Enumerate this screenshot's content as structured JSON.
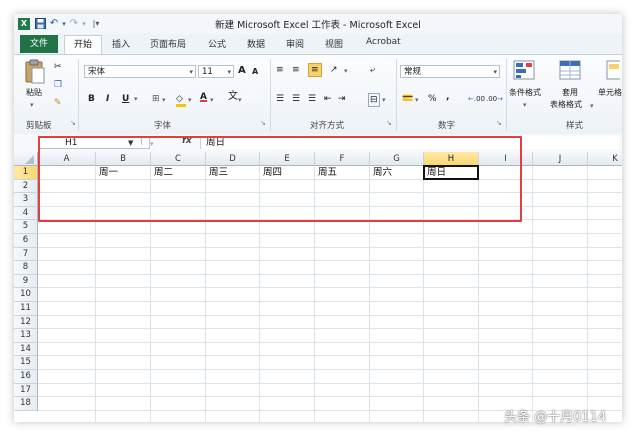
{
  "window": {
    "title": "新建 Microsoft Excel 工作表 - Microsoft Excel"
  },
  "quick_access": {
    "excel_icon": "excel-icon",
    "save_icon": "save-icon",
    "undo_icon": "undo-icon",
    "redo_icon": "redo-icon",
    "customize_icon": "customize-icon"
  },
  "tabs": [
    {
      "label": "文件"
    },
    {
      "label": "开始"
    },
    {
      "label": "插入"
    },
    {
      "label": "页面布局"
    },
    {
      "label": "公式"
    },
    {
      "label": "数据"
    },
    {
      "label": "审阅"
    },
    {
      "label": "视图"
    },
    {
      "label": "Acrobat"
    }
  ],
  "ribbon": {
    "clipboard": {
      "paste_label": "粘贴",
      "group_label": "剪贴板"
    },
    "font": {
      "name": "宋体",
      "size": "11",
      "bold": "B",
      "italic": "I",
      "underline": "U",
      "grow": "A",
      "shrink": "A",
      "wen": "wén",
      "group_label": "字体"
    },
    "alignment": {
      "group_label": "对齐方式"
    },
    "number": {
      "format": "常规",
      "percent": "%",
      "comma": ",",
      "inc_decimal": ".00",
      "dec_decimal": ".00",
      "group_label": "数字"
    },
    "styles": {
      "conditional": "条件格式",
      "table_format_1": "套用",
      "table_format_2": "表格格式",
      "cell_styles": "单元格",
      "group_label": "样式"
    }
  },
  "formula_bar": {
    "name_box": "H1",
    "fx": "fx",
    "content": "周日"
  },
  "sheet": {
    "columns": [
      "A",
      "B",
      "C",
      "D",
      "E",
      "F",
      "G",
      "H",
      "I",
      "J",
      "K"
    ],
    "selected_column": "H",
    "rows": [
      "1",
      "2",
      "3",
      "4",
      "5",
      "6",
      "7",
      "8",
      "9",
      "10",
      "11",
      "12",
      "13",
      "14",
      "15",
      "16",
      "17",
      "18"
    ],
    "selected_row": "1",
    "row1_values": [
      "",
      "周一",
      "周二",
      "周三",
      "周四",
      "周五",
      "周六",
      "周日"
    ]
  },
  "highlight_color": "#e0403f",
  "accent_color": "#217346",
  "watermark": "头条 @十月0114"
}
